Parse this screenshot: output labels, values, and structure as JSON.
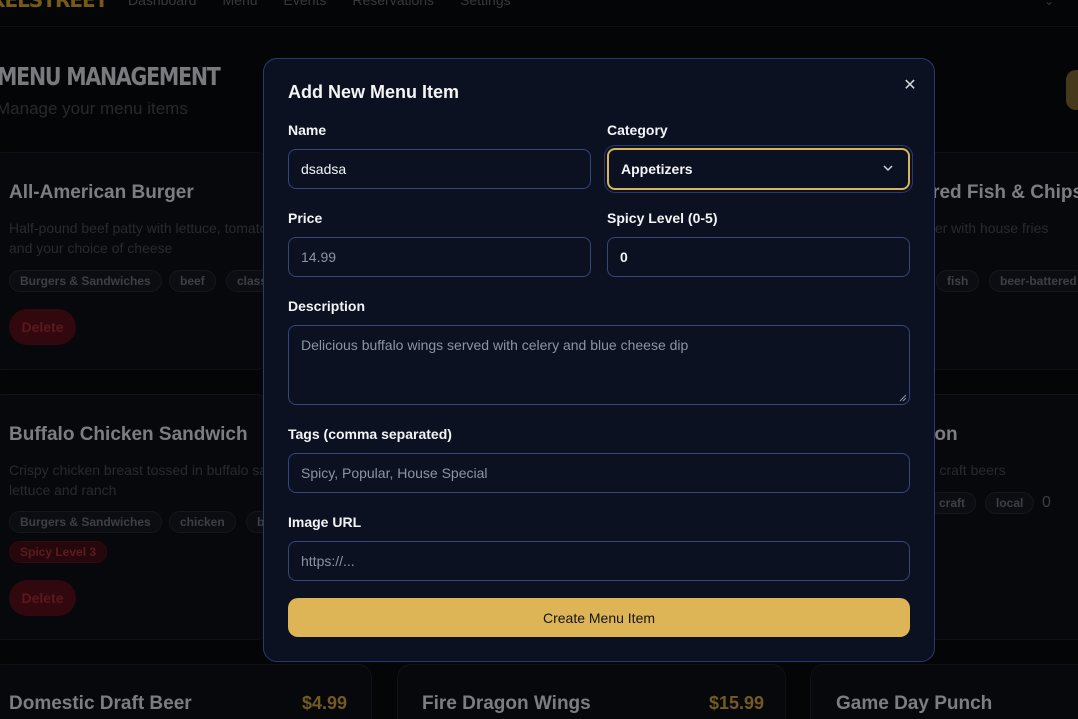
{
  "nav": {
    "brand": "PIXELSTREET",
    "links": [
      "Dashboard",
      "Menu",
      "Events",
      "Reservations",
      "Settings"
    ]
  },
  "page": {
    "title": "MENU MANAGEMENT",
    "subtitle": "Manage your menu items"
  },
  "cards": [
    {
      "title": "All-American Burger",
      "desc_line1": "Half-pound beef patty with lettuce, tomato",
      "desc_line2": "and your choice of cheese",
      "tags": [
        "Burgers & Sandwiches",
        "beef",
        "classic"
      ],
      "delete_label": "Delete"
    },
    {
      "title": "Beer-Battered Fish & Chips",
      "desc_line1": "Crispy beer batter with house fries",
      "tags": [
        "fish",
        "beer-battered"
      ]
    },
    {
      "title": "Buffalo Chicken Sandwich",
      "desc_line1": "Crispy chicken breast tossed in buffalo sauce",
      "desc_line2": "lettuce and ranch",
      "tags": [
        "Burgers & Sandwiches",
        "chicken",
        "buffalo"
      ],
      "spicy_label": "Spicy Level 3",
      "delete_label": "Delete"
    },
    {
      "title": "Craft Beer Selection",
      "desc_line1": "Rotating selection of local craft beers",
      "tags": [
        "craft",
        "local"
      ],
      "count": "0"
    },
    {
      "title": "Domestic Draft Beer",
      "price": "$4.99"
    },
    {
      "title": "Fire Dragon Wings",
      "price": "$15.99"
    },
    {
      "title": "Game Day Punch"
    }
  ],
  "modal": {
    "title": "Add New Menu Item",
    "close_icon": "close-icon",
    "name_label": "Name",
    "name_value": "dsadsa",
    "category_label": "Category",
    "category_value": "Appetizers",
    "price_label": "Price",
    "price_value": "14.99",
    "spicy_label": "Spicy Level (0-5)",
    "spicy_value": "0",
    "description_label": "Description",
    "description_value": "Delicious buffalo wings served with celery and blue cheese dip",
    "tags_label": "Tags (comma separated)",
    "tags_placeholder": "Spicy, Popular, House Special",
    "image_label": "Image URL",
    "image_placeholder": "https://...",
    "submit_label": "Create Menu Item"
  },
  "colors": {
    "accent": "#ddb456",
    "modal_bg": "#0b1120",
    "modal_border": "#2c3a6b",
    "danger": "#4a0d15"
  }
}
